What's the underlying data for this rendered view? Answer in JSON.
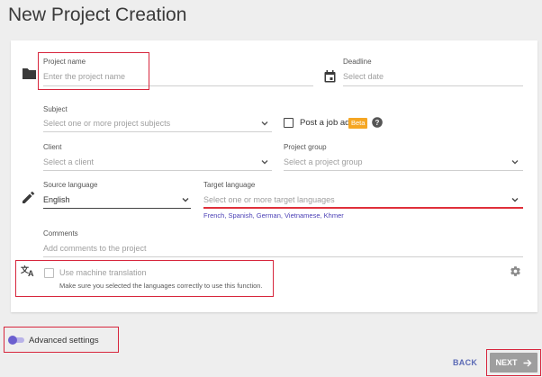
{
  "page": {
    "title": "New Project Creation"
  },
  "form": {
    "project_name": {
      "label": "Project name",
      "placeholder": "Enter the project name"
    },
    "deadline": {
      "label": "Deadline",
      "placeholder": "Select date"
    },
    "subject": {
      "label": "Subject",
      "placeholder": "Select one or more project subjects"
    },
    "job_ad": {
      "label": "Post a job ad",
      "badge": "Beta"
    },
    "client": {
      "label": "Client",
      "placeholder": "Select a client"
    },
    "project_group": {
      "label": "Project group",
      "placeholder": "Select a project group"
    },
    "source_language": {
      "label": "Source language",
      "value": "English"
    },
    "target_language": {
      "label": "Target language",
      "placeholder": "Select one or more target languages",
      "suggestions": "French, Spanish, German, Vietnamese, Khmer"
    },
    "comments": {
      "label": "Comments",
      "placeholder": "Add comments to the project"
    },
    "machine_translation": {
      "label": "Use machine translation",
      "hint": "Make sure you selected the languages correctly to use this function."
    }
  },
  "advanced": {
    "label": "Advanced settings"
  },
  "footer": {
    "back_label": "BACK",
    "next_label": "NEXT"
  },
  "colors": {
    "accent": "#6b5fcf",
    "badge": "#f5a623",
    "error": "#e0303a",
    "highlight": "#d7263d"
  }
}
